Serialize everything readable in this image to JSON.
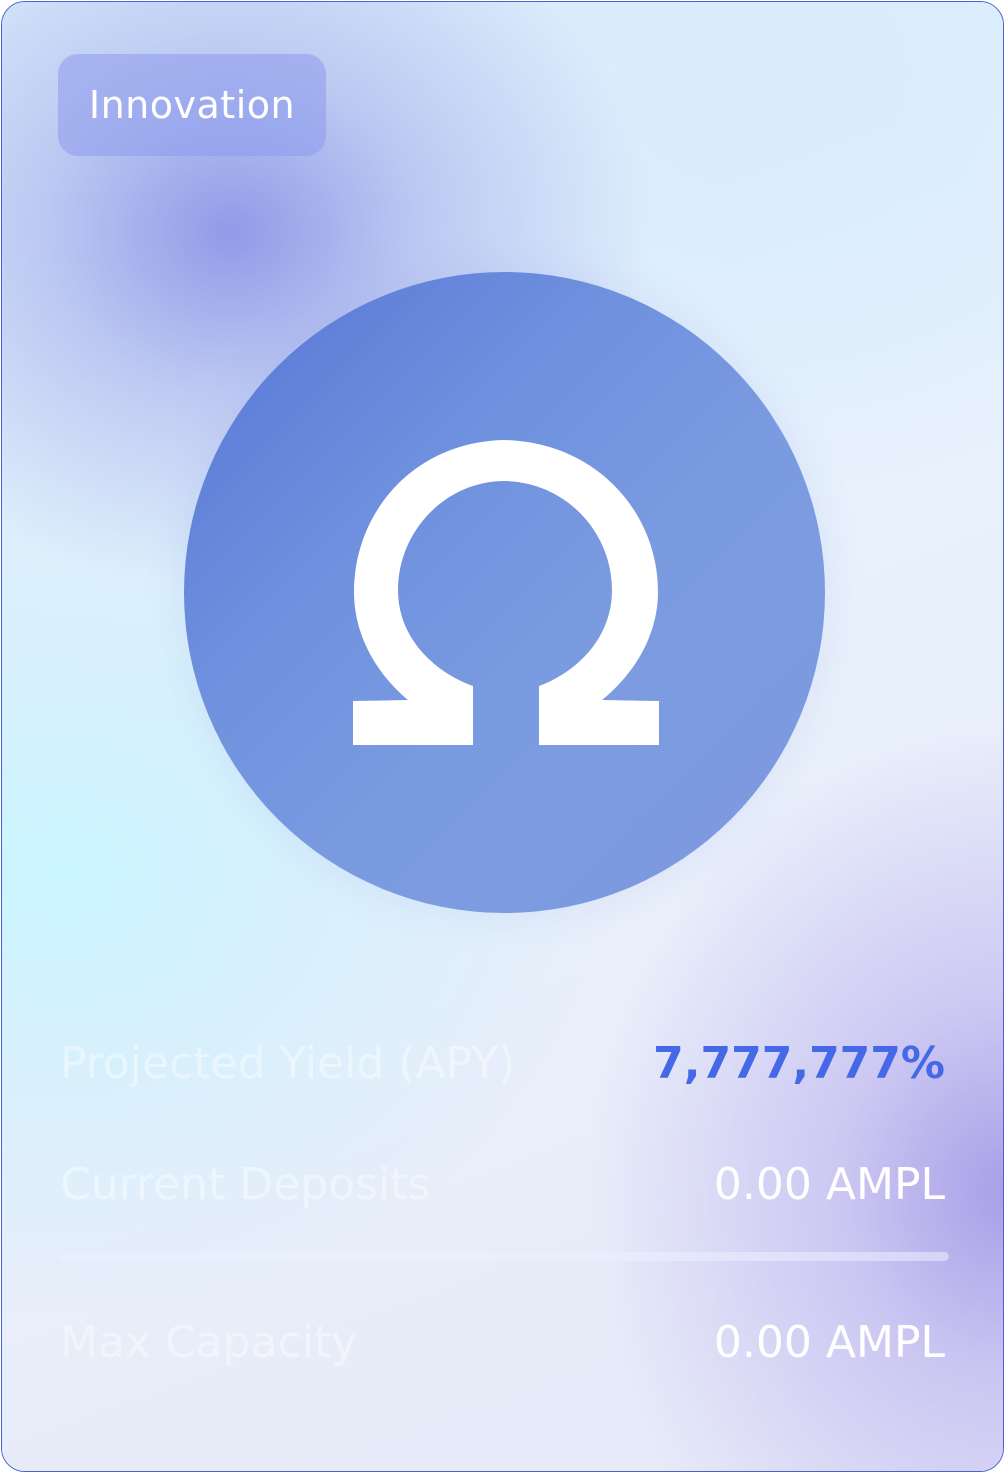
{
  "badge": {
    "label": "Innovation"
  },
  "logo": {
    "icon": "omega-icon",
    "color": "#6f91de"
  },
  "stats": {
    "apy_label": "Projected Yield (APY)",
    "apy_value": "7,777,777%",
    "deposits_label": "Current Deposits",
    "deposits_value": "0.00 AMPL",
    "capacity_label": "Max Capacity",
    "capacity_value": "0.00 AMPL"
  },
  "progress": {
    "fraction": 0
  },
  "colors": {
    "accent": "#4468e6",
    "border": "#4a62cf"
  }
}
